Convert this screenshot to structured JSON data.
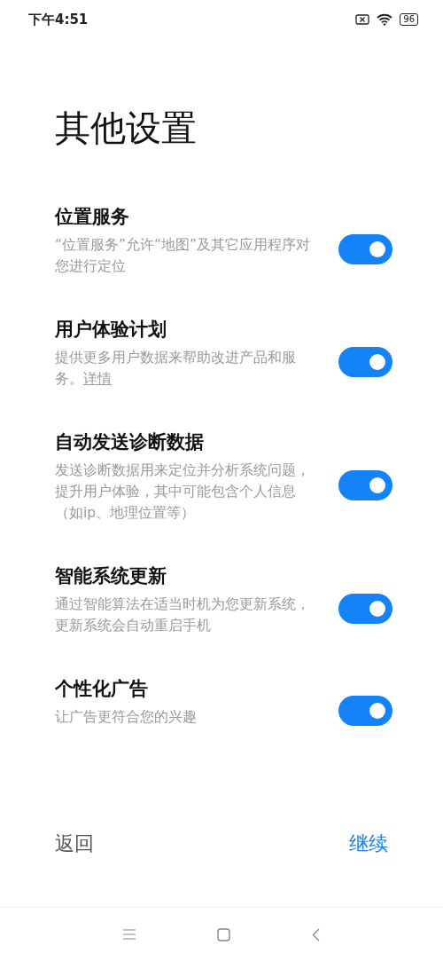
{
  "status_bar": {
    "time": "下午4:51",
    "battery": "96"
  },
  "title": "其他设置",
  "settings": [
    {
      "title": "位置服务",
      "description": "“位置服务”允许“地图”及其它应用程序对您进行定位",
      "on": true
    },
    {
      "title": "用户体验计划",
      "description": "提供更多用户数据来帮助改进产品和服务。",
      "link": "详情",
      "on": true
    },
    {
      "title": "自动发送诊断数据",
      "description": "发送诊断数据用来定位并分析系统问题，提升用户体验，其中可能包含个人信息（如ip、地理位置等）",
      "on": true
    },
    {
      "title": "智能系统更新",
      "description": "通过智能算法在适当时机为您更新系统，更新系统会自动重启手机",
      "on": true
    },
    {
      "title": "个性化广告",
      "description": "让广告更符合您的兴趣",
      "on": true
    }
  ],
  "footer": {
    "back": "返回",
    "continue": "继续"
  }
}
